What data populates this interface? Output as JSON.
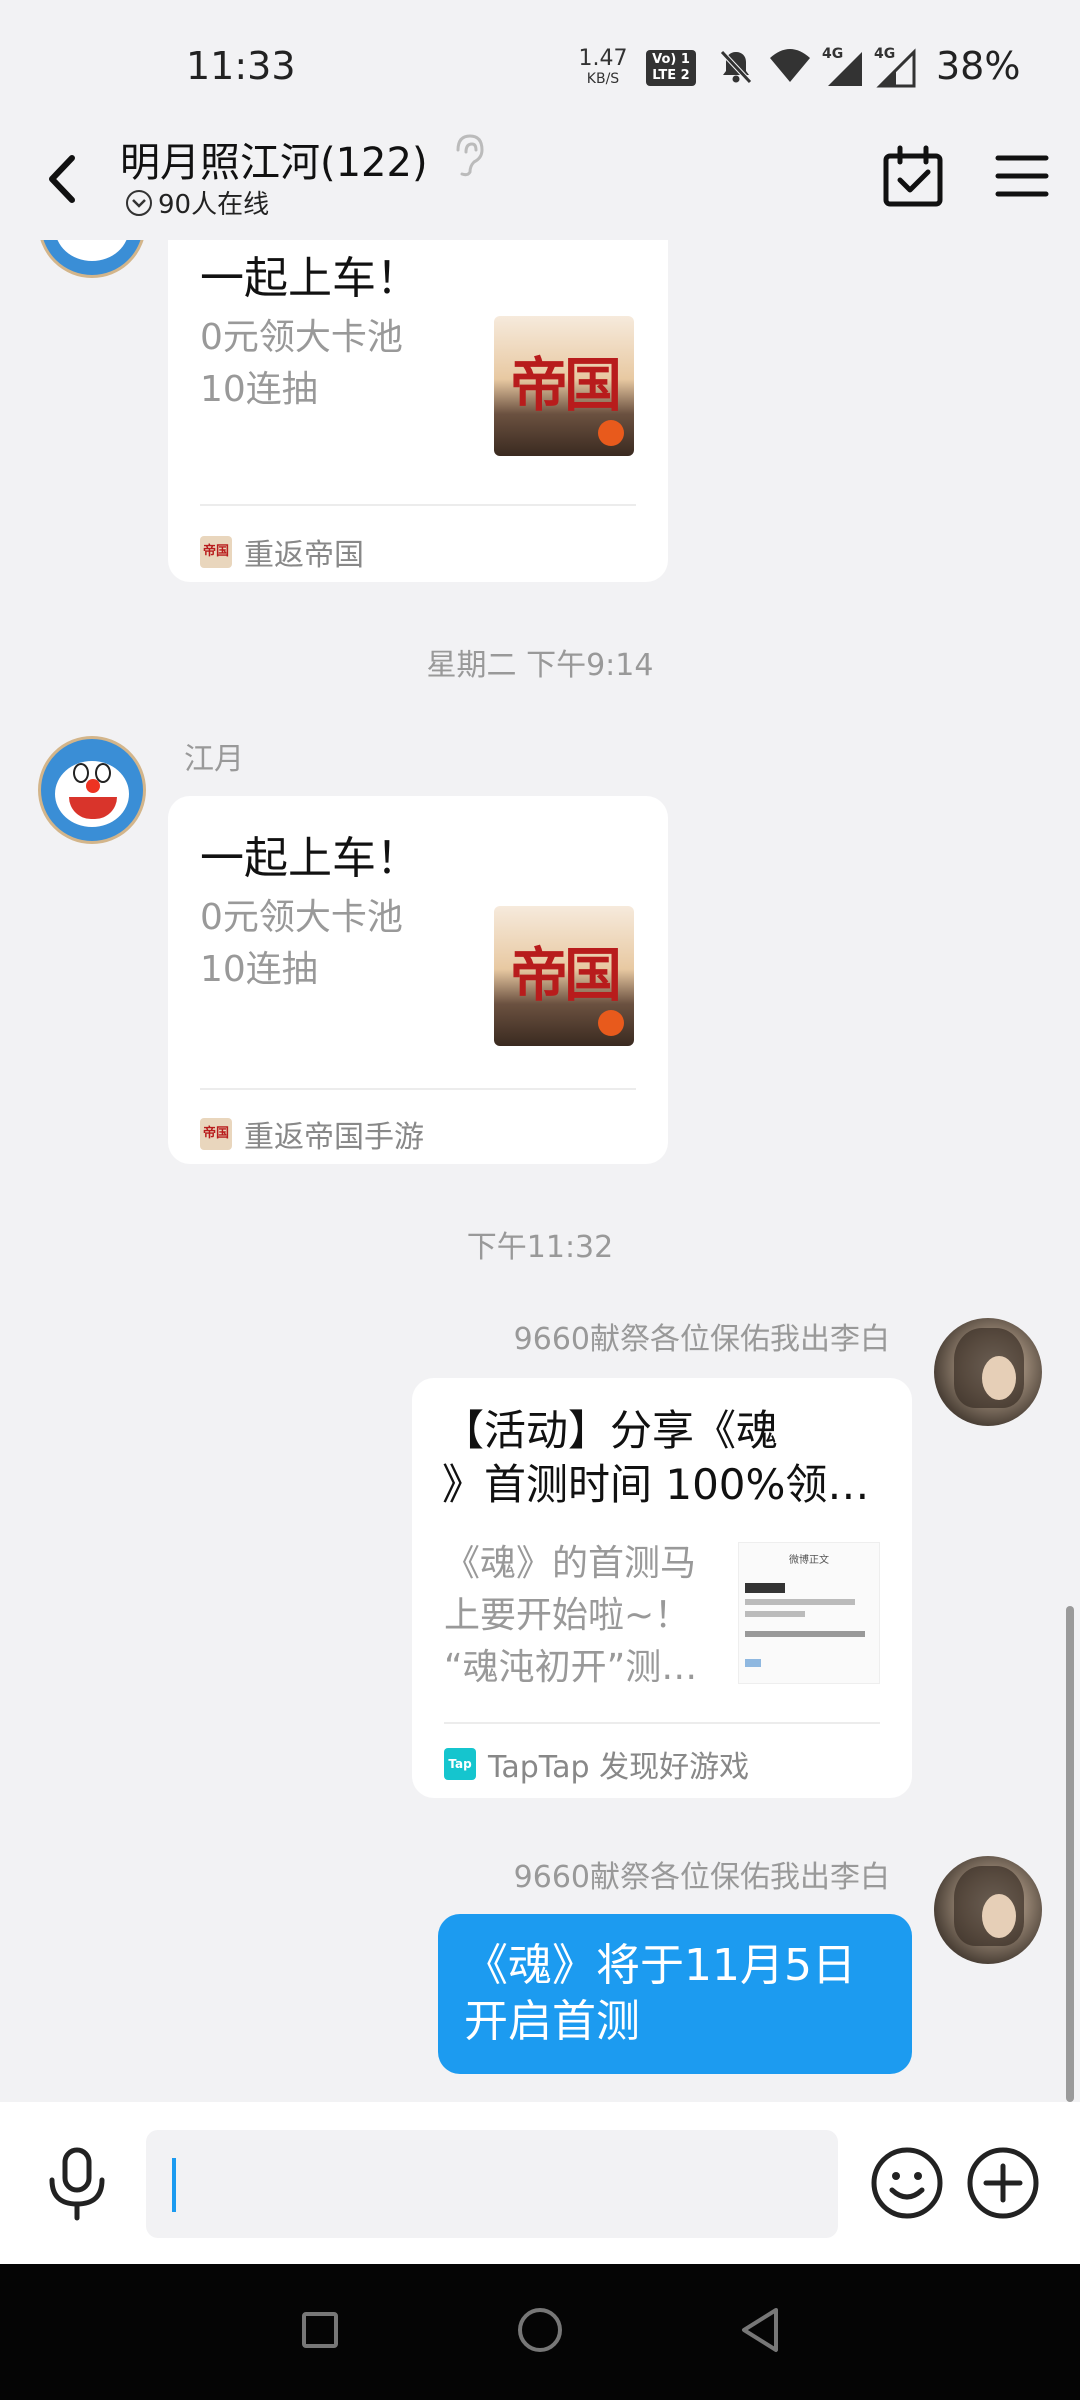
{
  "status_bar": {
    "time": "11:33",
    "net_speed_value": "1.47",
    "net_speed_unit": "KB/S",
    "volte_top": "Vo) 1",
    "volte_bottom": "LTE 2",
    "battery": "38%",
    "icons": [
      "mute-icon",
      "wifi-icon",
      "signal-4g-1-icon",
      "signal-4g-2-icon"
    ]
  },
  "header": {
    "title": "明月照江河(122)",
    "online_status": "90人在线"
  },
  "messages": [
    {
      "type": "share_card",
      "title": "一起上车！",
      "desc_lines": [
        "0元领大卡池",
        "10连抽"
      ],
      "thumb_text": "帝国",
      "source": "重返帝国"
    },
    {
      "type": "timestamp",
      "text": "星期二 下午9:14"
    },
    {
      "type": "share_card",
      "sender": "江月",
      "title": "一起上车！",
      "desc_lines": [
        "0元领大卡池",
        "10连抽"
      ],
      "thumb_text": "帝国",
      "source": "重返帝国手游"
    },
    {
      "type": "timestamp",
      "text": "下午11:32"
    },
    {
      "type": "share_card",
      "sender": "9660献祭各位保佑我出李白",
      "title_lines": [
        "【活动】分享《魂",
        "》首测时间 100%领…"
      ],
      "desc_lines": [
        "《魂》的首测马",
        "上要开始啦~！",
        "“魂沌初开”测…"
      ],
      "thumb_header": "微博正文",
      "source": "TapTap 发现好游戏",
      "source_icon": "Tap"
    },
    {
      "type": "text",
      "sender": "9660献祭各位保佑我出李白",
      "lines": [
        "《魂》将于11月5日",
        "开启首测"
      ]
    }
  ],
  "colors": {
    "accent": "#1c9bf0",
    "background": "#f2f2f4",
    "card": "#ffffff",
    "muted_text": "#999999"
  }
}
